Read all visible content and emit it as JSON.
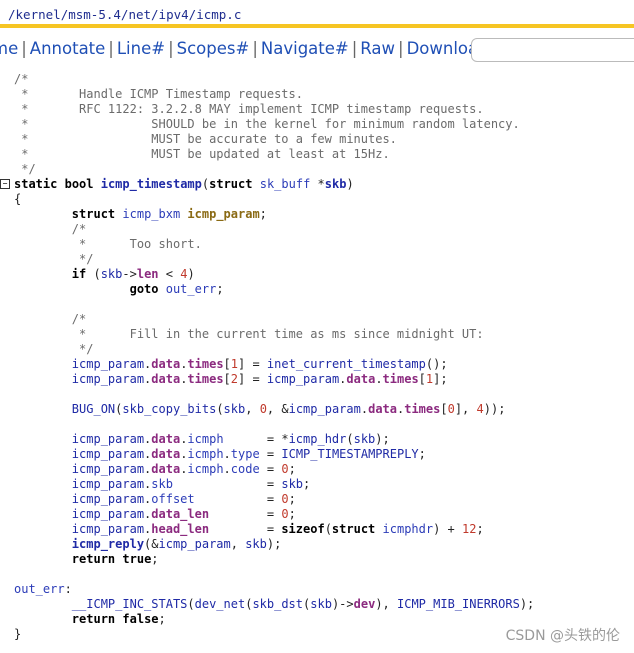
{
  "pathbar": {
    "segments": [
      "kernel",
      "msm-5.4",
      "net",
      "ipv4",
      "icmp.c"
    ]
  },
  "nav": {
    "items": [
      "me",
      "Annotate",
      "Line#",
      "Scopes#",
      "Navigate#",
      "Raw",
      "Download"
    ],
    "search_placeholder": ""
  },
  "code": {
    "lines": [
      "/*",
      " *\tHandle ICMP Timestamp requests.",
      " *\tRFC 1122: 3.2.2.8 MAY implement ICMP timestamp requests.",
      " *\t\t  SHOULD be in the kernel for minimum random latency.",
      " *\t\t  MUST be accurate to a few minutes.",
      " *\t\t  MUST be updated at least at 15Hz.",
      " */"
    ]
  },
  "watermark": "CSDN @头铁的伦"
}
